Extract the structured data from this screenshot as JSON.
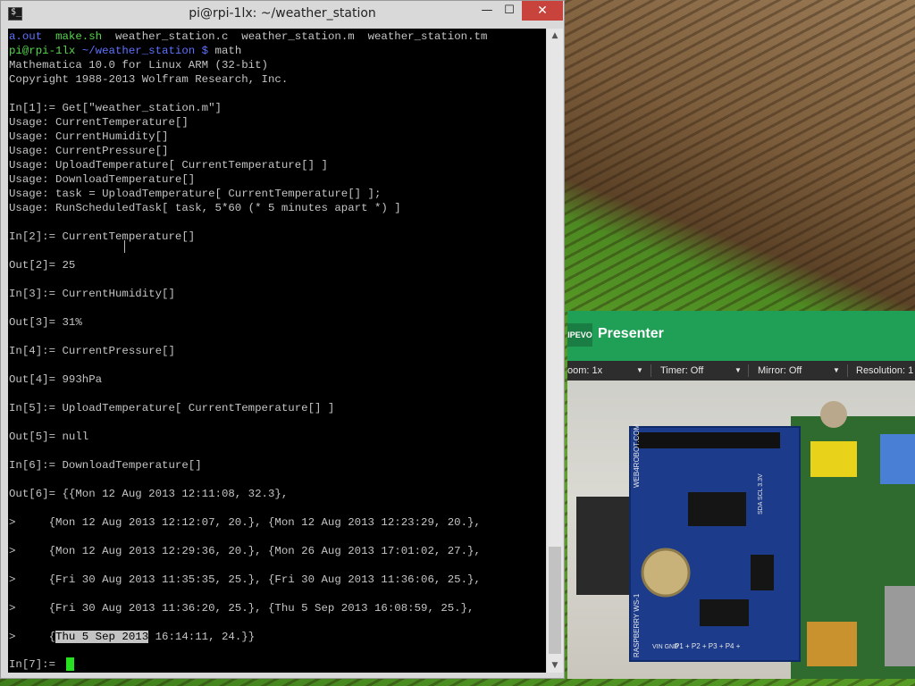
{
  "terminal": {
    "title": "pi@rpi-1lx: ~/weather_station",
    "icon": "terminal-icon",
    "icon_glyph": "$_",
    "controls": {
      "minimize": "—",
      "maximize": "☐",
      "close": "✕"
    },
    "ls_files": [
      "a.out",
      "make.sh",
      "weather_station.c",
      "weather_station.m",
      "weather_station.tm"
    ],
    "prompt": {
      "user_host": "pi@rpi-1lx",
      "path": "~/weather_station",
      "symbol": "$",
      "command": "math"
    },
    "lines": [
      "Mathematica 10.0 for Linux ARM (32-bit)",
      "Copyright 1988-2013 Wolfram Research, Inc.",
      "In[1]:= Get[\"weather_station.m\"]",
      "Usage: CurrentTemperature[]",
      "Usage: CurrentHumidity[]",
      "Usage: CurrentPressure[]",
      "Usage: UploadTemperature[ CurrentTemperature[] ]",
      "Usage: DownloadTemperature[]",
      "Usage: task = UploadTemperature[ CurrentTemperature[] ];",
      "Usage: RunScheduledTask[ task, 5*60 (* 5 minutes apart *) ]",
      "In[2]:= CurrentTemperature[]",
      "Out[2]= 25",
      "In[3]:= CurrentHumidity[]",
      "Out[3]= 31%",
      "In[4]:= CurrentPressure[]",
      "Out[4]= 993hPa",
      "In[5]:= UploadTemperature[ CurrentTemperature[] ]",
      "Out[5]= null",
      "In[6]:= DownloadTemperature[]",
      "Out[6]= {{Mon 12 Aug 2013 12:11:08, 32.3},",
      ">     {Mon 12 Aug 2013 12:12:07, 20.}, {Mon 12 Aug 2013 12:23:29, 20.},",
      ">     {Mon 12 Aug 2013 12:29:36, 20.}, {Mon 26 Aug 2013 17:01:02, 27.},",
      ">     {Fri 30 Aug 2013 11:35:35, 25.}, {Fri 30 Aug 2013 11:36:06, 25.},",
      ">     {Fri 30 Aug 2013 11:36:20, 25.}, {Thu 5 Sep 2013 16:08:59, 25.},"
    ],
    "last_output": {
      "prefix": ">     {",
      "selected": "Thu 5 Sep 2013",
      "suffix": " 16:14:11, 24.}}"
    },
    "input_prompt": "In[7]:= "
  },
  "presenter": {
    "logo": "IPEVO",
    "title": "Presenter",
    "toolbar": {
      "zoom": "oom: 1x",
      "timer": "Timer: Off",
      "mirror": "Mirror: Off",
      "resolution": "Resolution: 1"
    },
    "board_labels": {
      "brand": "WEB4ROBOT.COM",
      "model": "RASPBERRY WS-1",
      "pins": "P1 + P2 + P3 + P4 +",
      "power": "VIN GND",
      "i2c": "SDA SCL 3.3V"
    },
    "colors": {
      "header": "#20a056",
      "board": "#1c3b8a",
      "toolbar": "#2d2d2d"
    }
  }
}
